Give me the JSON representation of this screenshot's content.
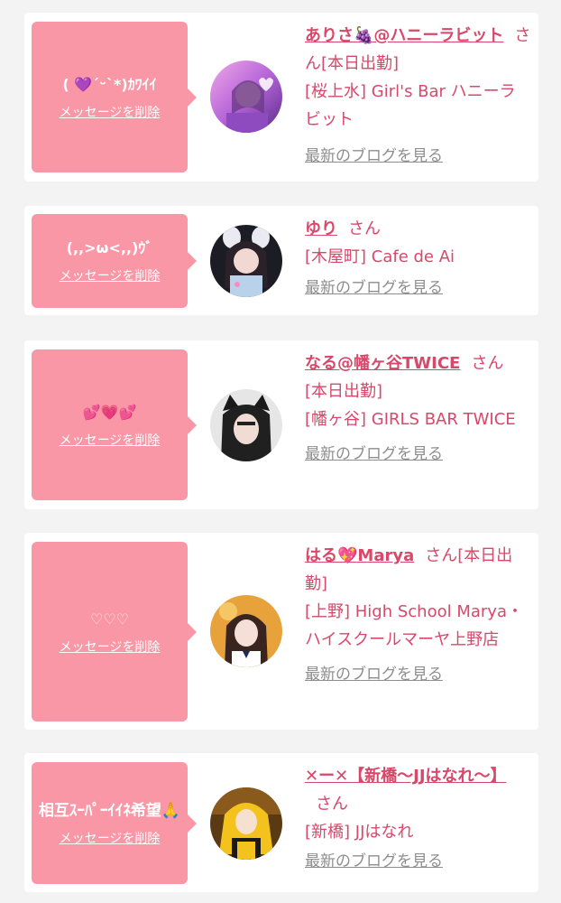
{
  "accent_color": "#d8486a",
  "bubble_color": "#fa97a6",
  "delete_label": "メッセージを削除",
  "blog_label": "最新のブログを見る",
  "cards": [
    {
      "message": "( 💜´ᵕ`*)ｶﾜｲｲ",
      "name": "ありさ🍇@ハニーラビット",
      "honorific": "さん",
      "status": "[本日出勤]",
      "shop": "[桜上水] Girl's Bar ハニーラビット",
      "avatar_icon": "avatar-photo-arisa"
    },
    {
      "message": "(,,>ω<,,)ｳﾞ",
      "name": "ゆり",
      "honorific": "さん",
      "status": "",
      "shop": "[木屋町] Cafe de Ai",
      "avatar_icon": "avatar-photo-yuri"
    },
    {
      "message": "💕💗💕",
      "name": "なる@幡ヶ谷TWICE",
      "honorific": "さん",
      "status": "[本日出勤]",
      "shop": "[幡ヶ谷] GIRLS BAR TWICE",
      "avatar_icon": "avatar-photo-naru"
    },
    {
      "message": "♡♡♡",
      "name": "はる💖Marya",
      "honorific": "さん",
      "status": "[本日出勤]",
      "shop": "[上野] High School Marya・ハイスクールマーヤ上野店",
      "avatar_icon": "avatar-photo-haru"
    },
    {
      "message": "相互ｽｰﾊﾟｰｲｲﾈ希望🙏",
      "name": "✕ー✕【新橋〜JJはなれ〜】",
      "honorific": "さん",
      "status": "",
      "shop": "[新橋] JJはなれ",
      "avatar_icon": "avatar-photo-jj"
    }
  ]
}
